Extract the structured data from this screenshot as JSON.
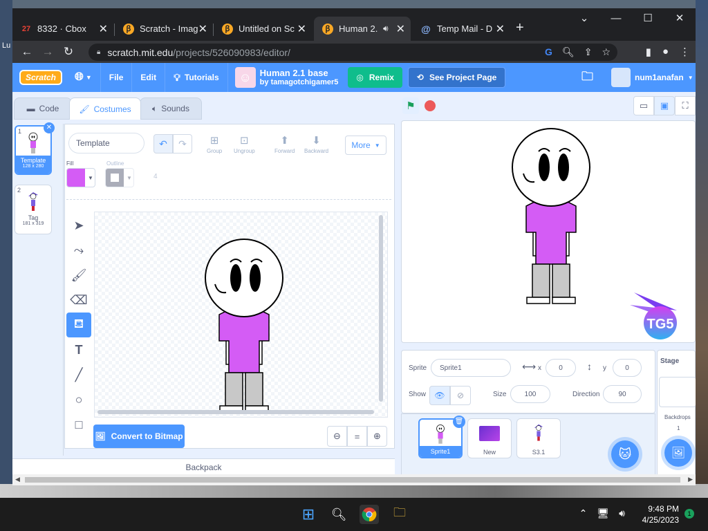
{
  "desktop": {
    "left_label": "Lu"
  },
  "browser": {
    "tabs": [
      {
        "title": "8332 · Cbox",
        "favicon": "27"
      },
      {
        "title": "Scratch - Imag",
        "favicon": ""
      },
      {
        "title": "Untitled on Sc",
        "favicon": ""
      },
      {
        "title": "Human 2.",
        "favicon": ""
      },
      {
        "title": "Temp Mail - D",
        "favicon": "@"
      }
    ],
    "url_host": "scratch.mit.edu",
    "url_path": "/projects/526090983/editor/"
  },
  "scratch": {
    "menu": {
      "logo": "Scratch",
      "file": "File",
      "edit": "Edit",
      "tutorials": "Tutorials"
    },
    "project": {
      "title": "Human 2.1 base",
      "author": "by tamagotchigamer5"
    },
    "remix": "Remix",
    "see_project": "See Project Page",
    "username": "num1anafan",
    "tabs": {
      "code": "Code",
      "costumes": "Costumes",
      "sounds": "Sounds"
    },
    "costumes": [
      {
        "num": "1",
        "name": "Template",
        "size": "128 x 280"
      },
      {
        "num": "2",
        "name": "Tag",
        "size": "181 x 319"
      }
    ],
    "paint": {
      "costume_name": "Template",
      "group": "Group",
      "ungroup": "Ungroup",
      "forward": "Forward",
      "backward": "Backward",
      "more": "More",
      "fill": "Fill",
      "outline": "Outline",
      "outline_width": "4",
      "fill_color": "#d45cf5",
      "convert": "Convert to Bitmap"
    },
    "backpack": "Backpack",
    "sprite": {
      "label": "Sprite",
      "name": "Sprite1",
      "x_label": "x",
      "x": "0",
      "y_label": "y",
      "y": "0",
      "show_label": "Show",
      "size_label": "Size",
      "size": "100",
      "direction_label": "Direction",
      "direction": "90"
    },
    "sprites": [
      {
        "name": "Sprite1"
      },
      {
        "name": "New"
      },
      {
        "name": "S3.1"
      }
    ],
    "stage": {
      "title": "Stage",
      "backdrops_label": "Backdrops",
      "backdrops_count": "1",
      "watermark": "TG5"
    }
  },
  "taskbar": {
    "time": "9:48 PM",
    "date": "4/25/2023",
    "notifications": "1"
  },
  "colors": {
    "scratch_blue": "#4c97ff",
    "remix_green": "#0fbd8c",
    "shirt_purple": "#d45cf5"
  }
}
